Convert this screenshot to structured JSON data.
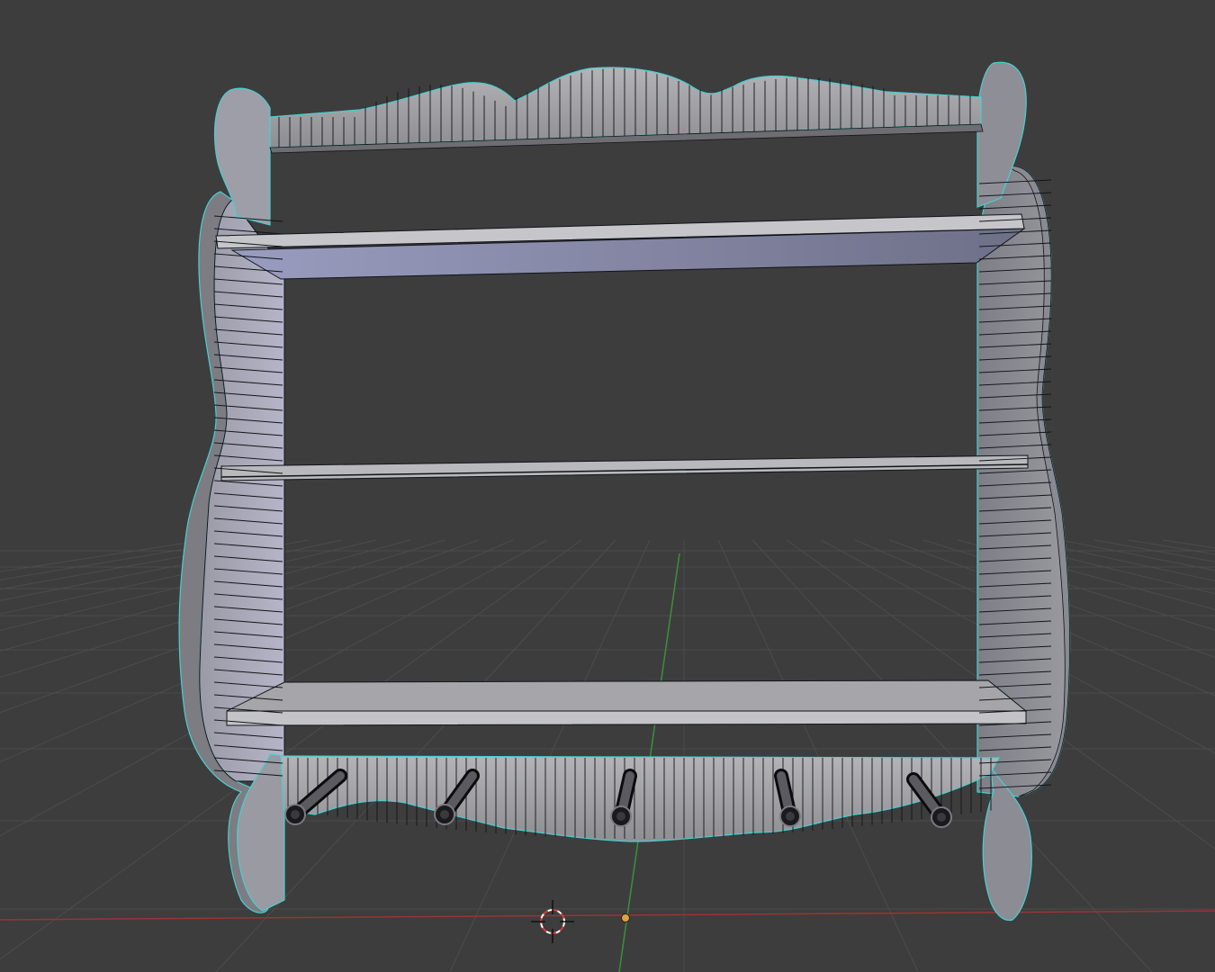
{
  "viewport": {
    "background": "#3d3d3d",
    "grid_color": "#4a4a4a",
    "x_axis_color": "#9a3434",
    "y_axis_color": "#3c8f3c",
    "wire_color": "#101418",
    "highlight_color": "#46d0d0",
    "face_light": "#a9a9ae",
    "face_shade": "#8f8fa8",
    "shelf_top": "#c8c8cc",
    "shelf_under": "#7c7e9a"
  },
  "scene": {
    "object": "wall-shelf-with-hooks",
    "shelves": 3,
    "hooks": 5,
    "mode": "object-wireframe-overlay"
  },
  "gizmos": {
    "cursor_3d_icon": "3d-cursor-icon",
    "origin_icon": "object-origin-dot",
    "origin_color": "#e0a040"
  }
}
